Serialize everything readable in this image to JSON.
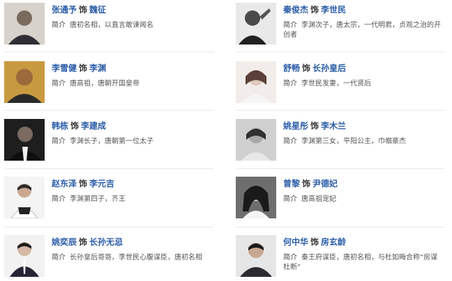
{
  "as_word": "饰",
  "intro_label": "简介",
  "cast": [
    {
      "actor": "张通予",
      "role": "魏征",
      "intro": "唐初名相，以直言敢谏闻名",
      "tone": "#7a6a5c"
    },
    {
      "actor": "秦俊杰",
      "role": "李世民",
      "intro": "李渊次子，唐太宗，一代明君，贞观之治的开创者",
      "tone": "#4a4a4a"
    },
    {
      "actor": "李雪健",
      "role": "李渊",
      "intro": "唐高祖，唐朝开国皇帝",
      "tone": "#b08a30"
    },
    {
      "actor": "舒畅",
      "role": "长孙皇后",
      "intro": "李世民发妻，一代贤后",
      "tone": "#d9c9bf"
    },
    {
      "actor": "韩栋",
      "role": "李建成",
      "intro": "李渊长子，唐朝第一位太子",
      "tone": "#3a3a3a"
    },
    {
      "actor": "姚星彤",
      "role": "李木兰",
      "intro": "李渊第三女，平阳公主，巾帼豪杰",
      "tone": "#8a8a8a"
    },
    {
      "actor": "赵东泽",
      "role": "李元吉",
      "intro": "李渊第四子，齐王",
      "tone": "#cfcfcf"
    },
    {
      "actor": "曾黎",
      "role": "尹德妃",
      "intro": "唐高祖宠妃",
      "tone": "#6a6a6a"
    },
    {
      "actor": "姚奕辰",
      "role": "长孙无忌",
      "intro": "长孙皇后哥哥，李世民心腹谋臣，唐初名相",
      "tone": "#3c3c3c"
    },
    {
      "actor": "何中华",
      "role": "房玄龄",
      "intro": "秦王府谋臣，唐初名相，与杜如晦合称“房谋杜断”",
      "tone": "#2f2f2f"
    }
  ]
}
